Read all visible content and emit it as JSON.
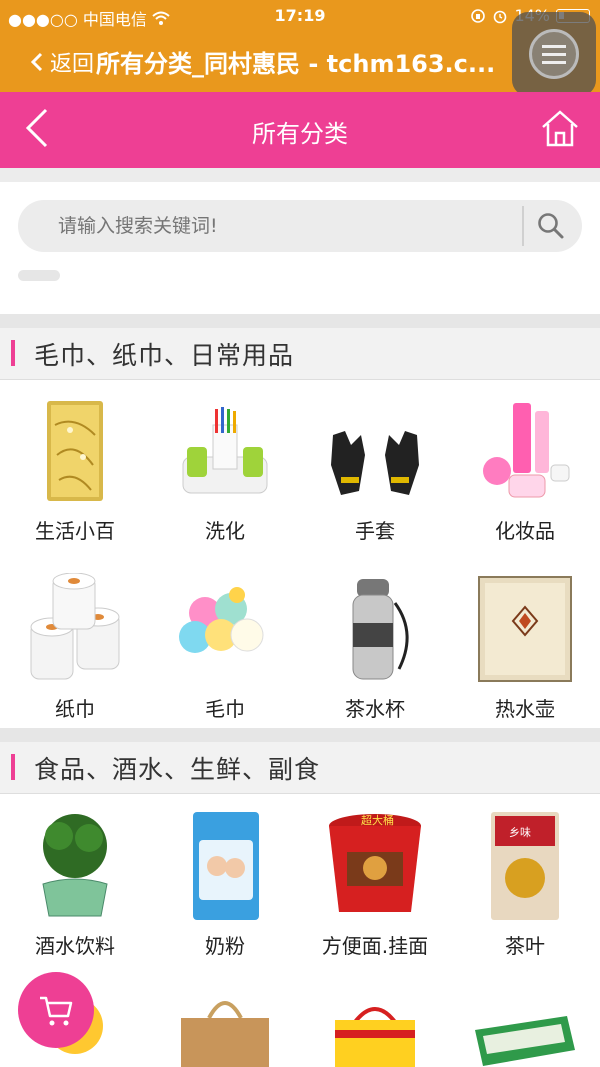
{
  "status_bar": {
    "carrier": "●●●○○ 中国电信",
    "time": "17:19",
    "battery": "14%"
  },
  "browser_bar": {
    "back_label": "返回",
    "title": "所有分类_同村惠民 - tchm163.c..."
  },
  "header": {
    "title": "所有分类"
  },
  "search": {
    "placeholder": "请输入搜索关键词!"
  },
  "sections": [
    {
      "title": "毛巾、纸巾、日常用品",
      "items": [
        "生活小百",
        "洗化",
        "手套",
        "化妆品",
        "纸巾",
        "毛巾",
        "茶水杯",
        "热水壶"
      ]
    },
    {
      "title": "食品、酒水、生鲜、副食",
      "items": [
        "酒水饮料",
        "奶粉",
        "方便面.挂面",
        "茶叶"
      ]
    }
  ],
  "colors": {
    "orange": "#e9981d",
    "pink": "#ee3f94"
  },
  "product_images": {
    "noodle_badge": "超大桶",
    "tea_pack_text": "乡味"
  }
}
